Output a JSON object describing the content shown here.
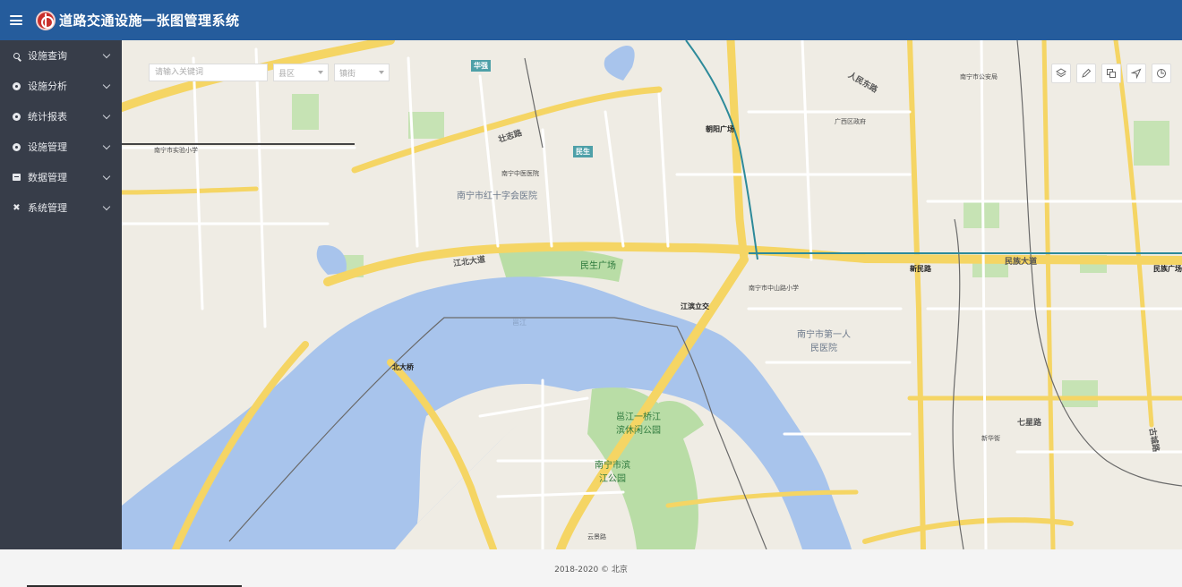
{
  "header": {
    "title": "道路交通设施一张图管理系统",
    "menu_icon": "hamburger-icon",
    "logo_icon": "traffic-logo-icon"
  },
  "sidebar": {
    "items": [
      {
        "label": "设施查询",
        "icon": "search-icon"
      },
      {
        "label": "设施分析",
        "icon": "analysis-icon"
      },
      {
        "label": "统计报表",
        "icon": "report-icon"
      },
      {
        "label": "设施管理",
        "icon": "manage-icon"
      },
      {
        "label": "数据管理",
        "icon": "database-icon"
      },
      {
        "label": "系统管理",
        "icon": "tools-icon"
      }
    ]
  },
  "search": {
    "placeholder": "请输入关键词",
    "district": "县区",
    "town": "镇街"
  },
  "map_tools": [
    "layers-icon",
    "edit-icon",
    "copy-icon",
    "navigate-icon",
    "measure-icon"
  ],
  "colors": {
    "header": "#255c9c",
    "sidebar": "#373d49",
    "water": "#a8c4ec",
    "road_major": "#f5d564",
    "park": "#b9dda6"
  },
  "map": {
    "labels": [
      {
        "text": "南宁市红十字会医院"
      },
      {
        "text": "民生广场"
      },
      {
        "text": "朝阳广场"
      },
      {
        "text": "江北大道"
      },
      {
        "text": "民族大道"
      },
      {
        "text": "新民路"
      },
      {
        "text": "北大桥"
      },
      {
        "text": "江滨立交"
      },
      {
        "text": "邕江一桥江滨休闲公园"
      },
      {
        "text": "南宁市滨江公园"
      },
      {
        "text": "南宁市第一人民医院"
      },
      {
        "text": "邕江"
      },
      {
        "text": "华强"
      },
      {
        "text": "民生"
      },
      {
        "text": "南宁中医医院"
      },
      {
        "text": "南宁市实验小学"
      },
      {
        "text": "广西区政府"
      },
      {
        "text": "民族广场"
      },
      {
        "text": "南宁市公安局"
      },
      {
        "text": "南宁市中山路小学"
      },
      {
        "text": "七星路"
      },
      {
        "text": "云景路"
      },
      {
        "text": "新华街"
      },
      {
        "text": "人民东路"
      },
      {
        "text": "古城路"
      },
      {
        "text": "壮志路"
      }
    ]
  },
  "footer": {
    "copyright": "2018-2020 © 北京"
  }
}
